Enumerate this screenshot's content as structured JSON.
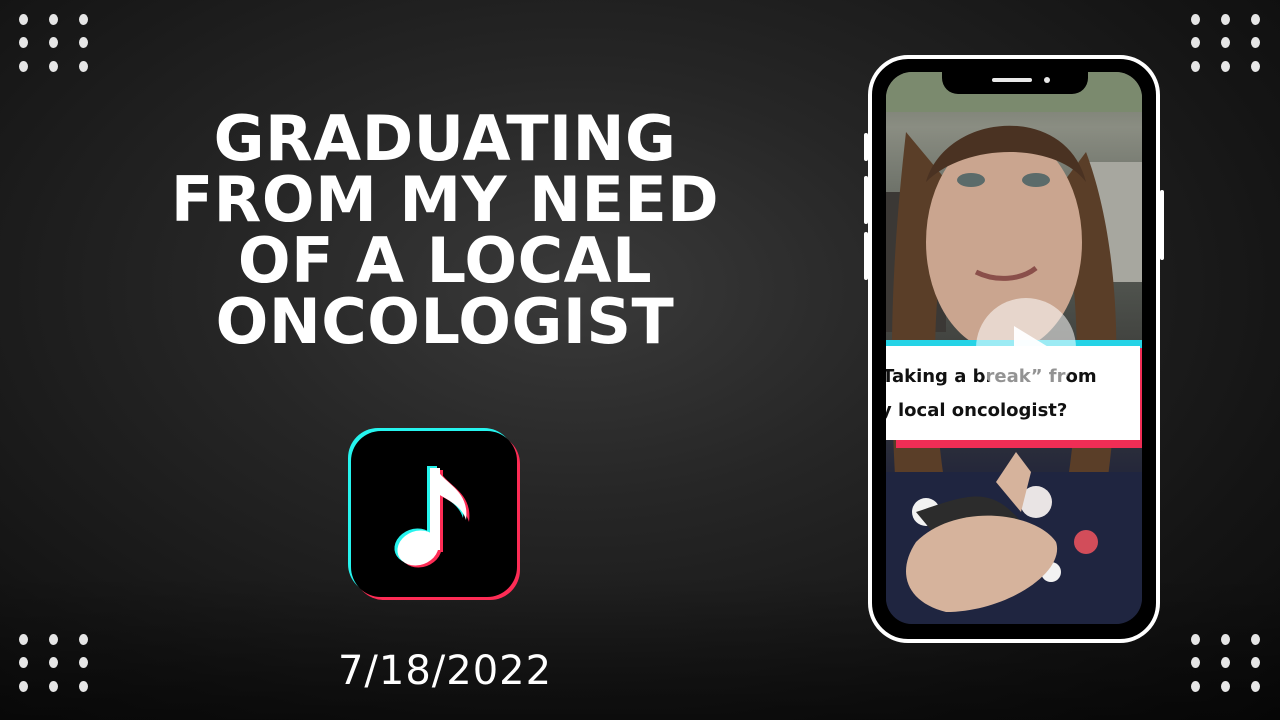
{
  "title": {
    "lines": [
      "GRADUATING",
      "FROM MY NEED",
      "OF A LOCAL",
      "ONCOLOGIST"
    ]
  },
  "app_icon": {
    "name": "tiktok-music-note-icon"
  },
  "date": "7/18/2022",
  "phone": {
    "caption": {
      "line1": "Taking a break” from",
      "line2": "y local oncologist?"
    },
    "play_icon": "play-icon"
  },
  "colors": {
    "background": "#1e1e1e",
    "accent_cyan": "#25f4ee",
    "accent_red": "#fe2c55",
    "text": "#ffffff"
  }
}
